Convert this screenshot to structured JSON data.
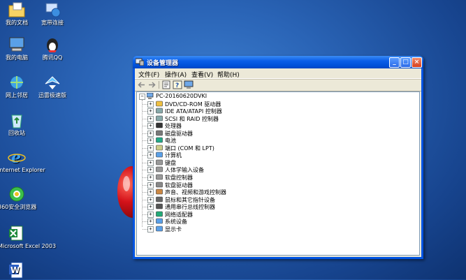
{
  "desktop": {
    "icons": [
      {
        "name": "my-documents",
        "label": "我的文档"
      },
      {
        "name": "broadband",
        "label": "宽带连接"
      },
      {
        "name": "my-computer",
        "label": "我的电脑"
      },
      {
        "name": "tencent-qq",
        "label": "腾讯QQ"
      },
      {
        "name": "network-neighborhood",
        "label": "网上邻居"
      },
      {
        "name": "xunlei",
        "label": "迅雷极速版"
      },
      {
        "name": "recycle-bin",
        "label": "回收站"
      },
      {
        "name": "internet-explorer",
        "label": "Internet Explorer"
      },
      {
        "name": "360-browser",
        "label": "360安全浏览器"
      },
      {
        "name": "excel",
        "label": "Microsoft Excel 2003"
      },
      {
        "name": "word",
        "label": ""
      }
    ]
  },
  "window": {
    "title": "设备管理器",
    "menu": [
      "文件(F)",
      "操作(A)",
      "查看(V)",
      "帮助(H)"
    ],
    "controls": {
      "minimize": "_",
      "maximize": "□",
      "close": "×"
    }
  },
  "tree": {
    "root": "PC-20160620DVKI",
    "children": [
      {
        "label": "DVD/CD-ROM 驱动器",
        "icon": "cdrom-icon"
      },
      {
        "label": "IDE ATA/ATAPI 控制器",
        "icon": "ide-controller-icon"
      },
      {
        "label": "SCSI 和 RAID 控制器",
        "icon": "scsi-controller-icon"
      },
      {
        "label": "处理器",
        "icon": "processor-icon"
      },
      {
        "label": "磁盘驱动器",
        "icon": "disk-drive-icon"
      },
      {
        "label": "电池",
        "icon": "battery-icon"
      },
      {
        "label": "端口 (COM 和 LPT)",
        "icon": "port-icon"
      },
      {
        "label": "计算机",
        "icon": "computer-icon"
      },
      {
        "label": "键盘",
        "icon": "keyboard-icon"
      },
      {
        "label": "人体学输入设备",
        "icon": "hid-icon"
      },
      {
        "label": "软盘控制器",
        "icon": "floppy-controller-icon"
      },
      {
        "label": "软盘驱动器",
        "icon": "floppy-drive-icon"
      },
      {
        "label": "声音、视频和游戏控制器",
        "icon": "sound-icon"
      },
      {
        "label": "鼠标和其它指针设备",
        "icon": "mouse-icon"
      },
      {
        "label": "通用串行总线控制器",
        "icon": "usb-icon"
      },
      {
        "label": "网络适配器",
        "icon": "network-adapter-icon"
      },
      {
        "label": "系统设备",
        "icon": "system-device-icon"
      },
      {
        "label": "显示卡",
        "icon": "display-adapter-icon"
      }
    ]
  },
  "colors": {
    "desktop": "#2a64b6",
    "titlebar": "#0054e3",
    "window_face": "#ece9d8"
  }
}
